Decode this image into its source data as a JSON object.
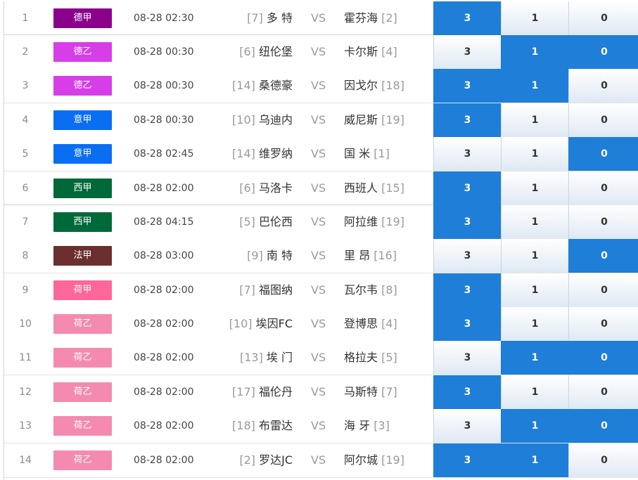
{
  "vs_label": "VS",
  "colors": {
    "selected": "#1e7ed8",
    "league_colors": {
      "德甲": "#8b008b",
      "德乙": "#d63ee8",
      "意甲": "#0a6ef2",
      "西甲": "#00693a",
      "法甲": "#6b2f2f",
      "荷甲": "#ff6699",
      "荷乙": "#f48ab0"
    }
  },
  "matches": [
    {
      "num": "1",
      "league": "德甲",
      "time": "08-28 02:30",
      "home_rank": "[7]",
      "home": "多 特",
      "away": "霍芬海",
      "away_rank": "[2]",
      "opts": [
        "3",
        "1",
        "0"
      ],
      "selected": [
        true,
        false,
        false
      ]
    },
    {
      "num": "2",
      "league": "德乙",
      "time": "08-28 00:30",
      "home_rank": "[6]",
      "home": "纽伦堡",
      "away": "卡尔斯",
      "away_rank": "[4]",
      "opts": [
        "3",
        "1",
        "0"
      ],
      "selected": [
        false,
        true,
        true
      ]
    },
    {
      "num": "3",
      "league": "德乙",
      "time": "08-28 00:30",
      "home_rank": "[14]",
      "home": "桑德豪",
      "away": "因戈尔",
      "away_rank": "[18]",
      "opts": [
        "3",
        "1",
        "0"
      ],
      "selected": [
        true,
        true,
        false
      ]
    },
    {
      "num": "4",
      "league": "意甲",
      "time": "08-28 00:30",
      "home_rank": "[10]",
      "home": "乌迪内",
      "away": "威尼斯",
      "away_rank": "[19]",
      "opts": [
        "3",
        "1",
        "0"
      ],
      "selected": [
        true,
        false,
        false
      ]
    },
    {
      "num": "5",
      "league": "意甲",
      "time": "08-28 02:45",
      "home_rank": "[14]",
      "home": "维罗纳",
      "away": "国 米",
      "away_rank": "[1]",
      "opts": [
        "3",
        "1",
        "0"
      ],
      "selected": [
        false,
        false,
        true
      ]
    },
    {
      "num": "6",
      "league": "西甲",
      "time": "08-28 02:00",
      "home_rank": "[6]",
      "home": "马洛卡",
      "away": "西班人",
      "away_rank": "[15]",
      "opts": [
        "3",
        "1",
        "0"
      ],
      "selected": [
        true,
        false,
        false
      ]
    },
    {
      "num": "7",
      "league": "西甲",
      "time": "08-28 04:15",
      "home_rank": "[5]",
      "home": "巴伦西",
      "away": "阿拉维",
      "away_rank": "[19]",
      "opts": [
        "3",
        "1",
        "0"
      ],
      "selected": [
        true,
        false,
        false
      ]
    },
    {
      "num": "8",
      "league": "法甲",
      "time": "08-28 03:00",
      "home_rank": "[9]",
      "home": "南 特",
      "away": "里 昂",
      "away_rank": "[16]",
      "opts": [
        "3",
        "1",
        "0"
      ],
      "selected": [
        false,
        false,
        true
      ]
    },
    {
      "num": "9",
      "league": "荷甲",
      "time": "08-28 02:00",
      "home_rank": "[7]",
      "home": "福图纳",
      "away": "瓦尔韦",
      "away_rank": "[8]",
      "opts": [
        "3",
        "1",
        "0"
      ],
      "selected": [
        true,
        false,
        false
      ]
    },
    {
      "num": "10",
      "league": "荷乙",
      "time": "08-28 02:00",
      "home_rank": "[10]",
      "home": "埃因FC",
      "away": "登博思",
      "away_rank": "[4]",
      "opts": [
        "3",
        "1",
        "0"
      ],
      "selected": [
        true,
        false,
        false
      ]
    },
    {
      "num": "11",
      "league": "荷乙",
      "time": "08-28 02:00",
      "home_rank": "[13]",
      "home": "埃 门",
      "away": "格拉夫",
      "away_rank": "[5]",
      "opts": [
        "3",
        "1",
        "0"
      ],
      "selected": [
        false,
        true,
        true
      ]
    },
    {
      "num": "12",
      "league": "荷乙",
      "time": "08-28 02:00",
      "home_rank": "[17]",
      "home": "福伦丹",
      "away": "马斯特",
      "away_rank": "[7]",
      "opts": [
        "3",
        "1",
        "0"
      ],
      "selected": [
        true,
        false,
        false
      ]
    },
    {
      "num": "13",
      "league": "荷乙",
      "time": "08-28 02:00",
      "home_rank": "[18]",
      "home": "布雷达",
      "away": "海 牙",
      "away_rank": "[3]",
      "opts": [
        "3",
        "1",
        "0"
      ],
      "selected": [
        false,
        true,
        true
      ]
    },
    {
      "num": "14",
      "league": "荷乙",
      "time": "08-28 02:00",
      "home_rank": "[2]",
      "home": "罗达JC",
      "away": "阿尔城",
      "away_rank": "[19]",
      "opts": [
        "3",
        "1",
        "0"
      ],
      "selected": [
        true,
        true,
        false
      ]
    }
  ]
}
